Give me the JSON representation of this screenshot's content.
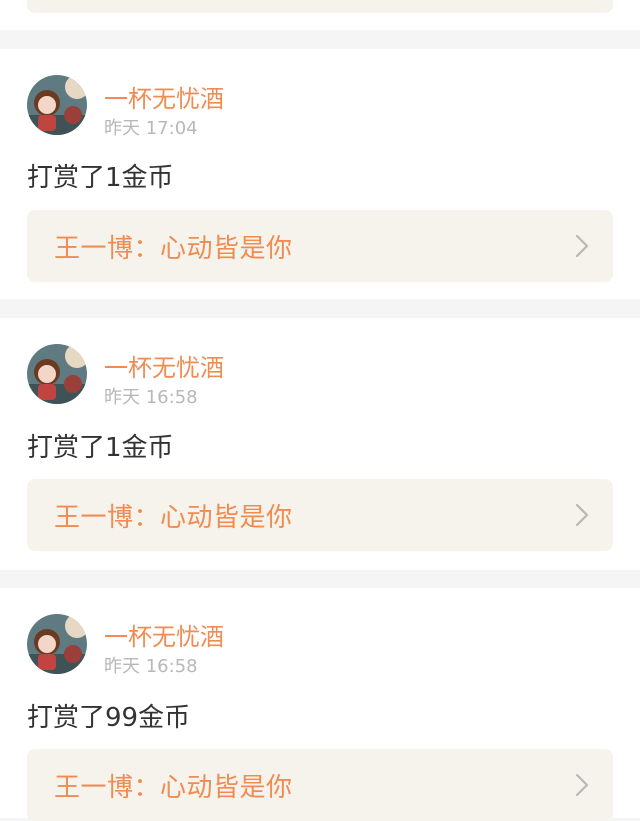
{
  "posts": [
    {
      "user": "一杯无忧酒",
      "time": "昨天 17:04",
      "action": "打赏了1金币",
      "ref": "王一博：心动皆是你",
      "avatar": "avatar-cartoon-girl"
    },
    {
      "user": "一杯无忧酒",
      "time": "昨天 16:58",
      "action": "打赏了1金币",
      "ref": "王一博：心动皆是你",
      "avatar": "avatar-cartoon-girl"
    },
    {
      "user": "一杯无忧酒",
      "time": "昨天 16:58",
      "action": "打赏了99金币",
      "ref": "王一博：心动皆是你",
      "avatar": "avatar-cartoon-girl"
    }
  ],
  "colors": {
    "accent": "#f08c52",
    "text": "#333333",
    "muted": "#b8b8b8",
    "box": "#f5f3ec",
    "background": "#f5f5f5"
  }
}
